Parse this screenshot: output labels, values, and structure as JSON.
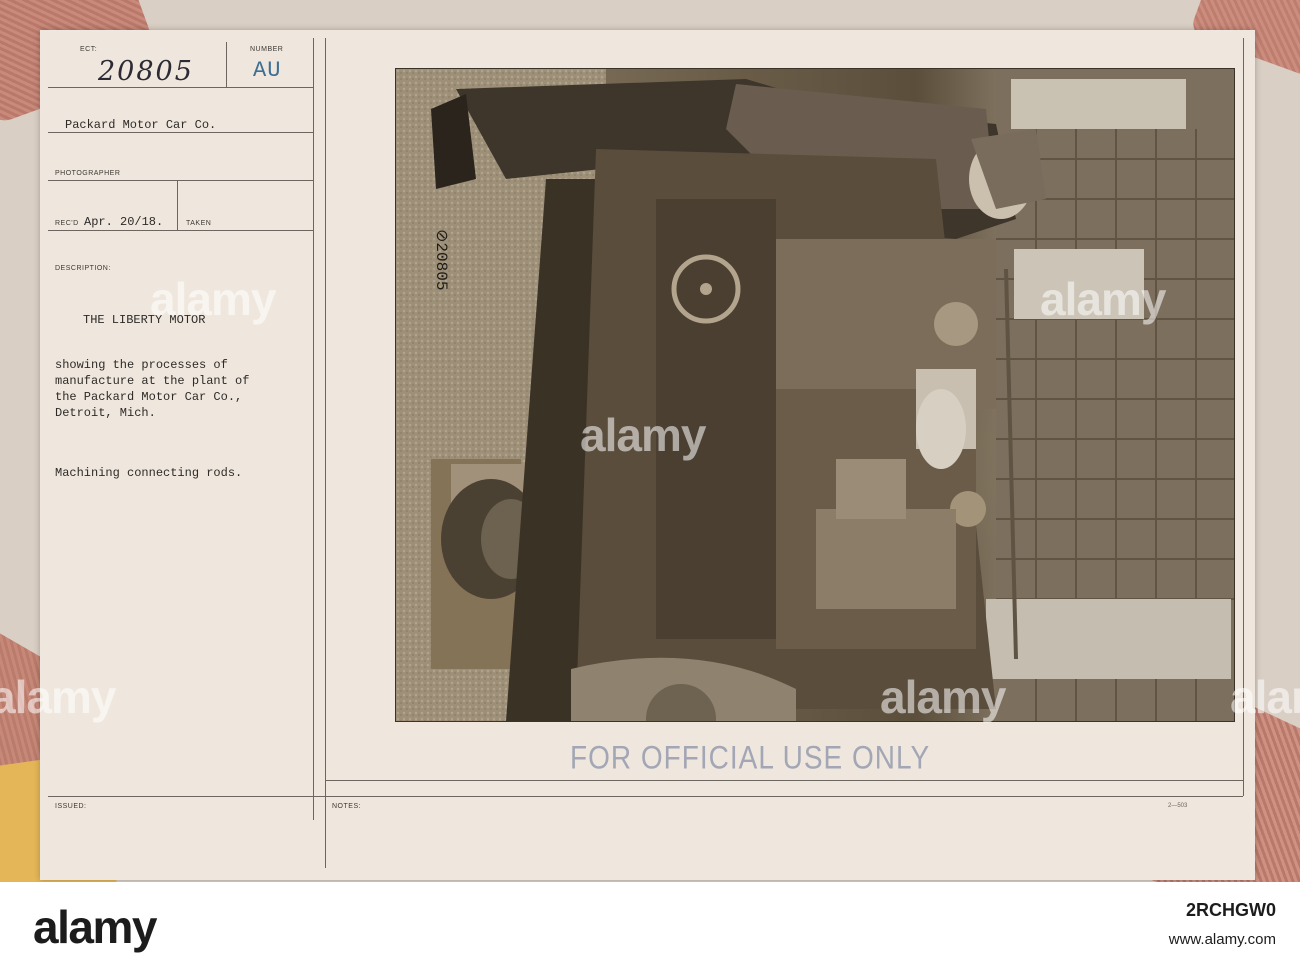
{
  "card": {
    "subject_label": "ECT:",
    "number_label": "NUMBER",
    "record_number": "20805",
    "series_code": "AU",
    "source": "Packard Motor Car Co.",
    "photographer_label": "PHOTOGRAPHER",
    "received_label": "REC'D",
    "received_date": "Apr. 20/18.",
    "taken_label": "TAKEN",
    "description_label": "DESCRIPTION:",
    "title": "THE LIBERTY MOTOR",
    "description_lines": [
      "showing the processes of",
      "manufacture at the plant of",
      "the Packard Motor Car Co.,",
      "Detroit, Mich."
    ],
    "caption": "Machining connecting rods.",
    "issued_label": "ISSUED:",
    "notes_label": "NOTES:",
    "stamp": "FOR OFFICIAL USE ONLY",
    "form_code": "2—503"
  },
  "photo": {
    "negative_number": "⊘20805"
  },
  "watermark": {
    "text": "alamy"
  },
  "footer": {
    "logo": "alamy",
    "image_id": "2RCHGW0",
    "site": "www.alamy.com"
  }
}
